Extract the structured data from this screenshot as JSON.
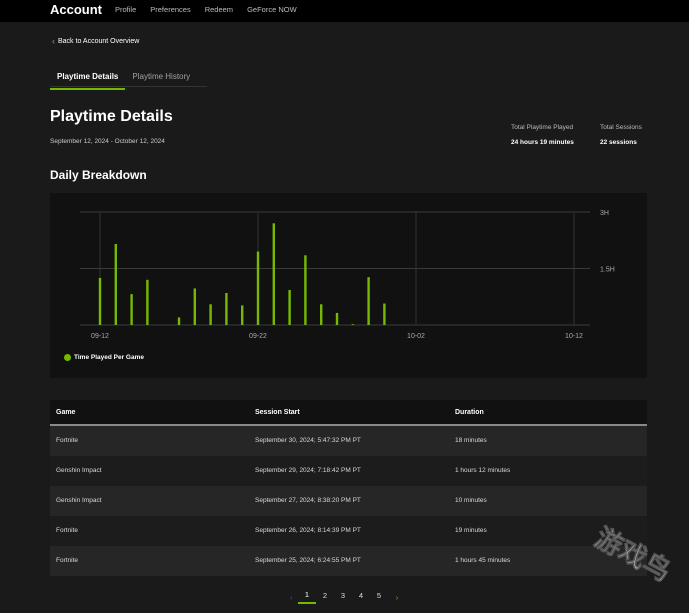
{
  "header": {
    "brand": "Account",
    "nav": [
      "Profile",
      "Preferences",
      "Redeem",
      "GeForce NOW"
    ]
  },
  "back_link": "Back to Account Overview",
  "tabs": [
    {
      "label": "Playtime Details",
      "active": true
    },
    {
      "label": "Playtime History",
      "active": false
    }
  ],
  "page": {
    "title": "Playtime Details",
    "date_range": "September 12, 2024 - October 12, 2024",
    "stats": [
      {
        "label": "Total Playtime Played",
        "value": "24 hours 19 minutes"
      },
      {
        "label": "Total Sessions",
        "value": "22 sessions"
      }
    ]
  },
  "breakdown": {
    "title": "Daily Breakdown",
    "legend": "Time Played Per Game"
  },
  "chart_data": {
    "type": "bar",
    "x_ticks": [
      "09-12",
      "09-22",
      "10-02",
      "10-12"
    ],
    "y_ticks": [
      "1.5H",
      "3H"
    ],
    "ylim": [
      0,
      3
    ],
    "grid": true,
    "color": "#76b900",
    "series": [
      {
        "x": [
          "09-12",
          "09-13",
          "09-14",
          "09-15",
          "09-17",
          "09-18",
          "09-19",
          "09-20",
          "09-21",
          "09-22",
          "09-23",
          "09-24",
          "09-25",
          "09-26",
          "09-27",
          "09-28",
          "09-29",
          "09-30"
        ],
        "values": [
          1.25,
          2.15,
          0.82,
          1.2,
          0.2,
          0.97,
          0.55,
          0.85,
          0.52,
          1.95,
          2.7,
          0.93,
          1.85,
          0.55,
          0.32,
          0.02,
          1.27,
          0.57
        ]
      }
    ]
  },
  "table": {
    "headers": [
      "Game",
      "Session Start",
      "Duration"
    ],
    "rows": [
      [
        "Fortnite",
        "September 30, 2024; 5:47:32 PM PT",
        "18 minutes"
      ],
      [
        "Genshin Impact",
        "September 29, 2024; 7:18:42 PM PT",
        "1 hours 12 minutes"
      ],
      [
        "Genshin Impact",
        "September 27, 2024; 8:38:20 PM PT",
        "10 minutes"
      ],
      [
        "Fortnite",
        "September 26, 2024; 8:14:39 PM PT",
        "19 minutes"
      ],
      [
        "Fortnite",
        "September 25, 2024; 6:24:55 PM PT",
        "1 hours 45 minutes"
      ]
    ]
  },
  "pagination": {
    "pages": [
      "1",
      "2",
      "3",
      "4",
      "5"
    ],
    "current": "1",
    "prev_icon": "chevron-left-icon",
    "next_icon": "chevron-right-icon"
  },
  "watermark": "游戏鸟"
}
